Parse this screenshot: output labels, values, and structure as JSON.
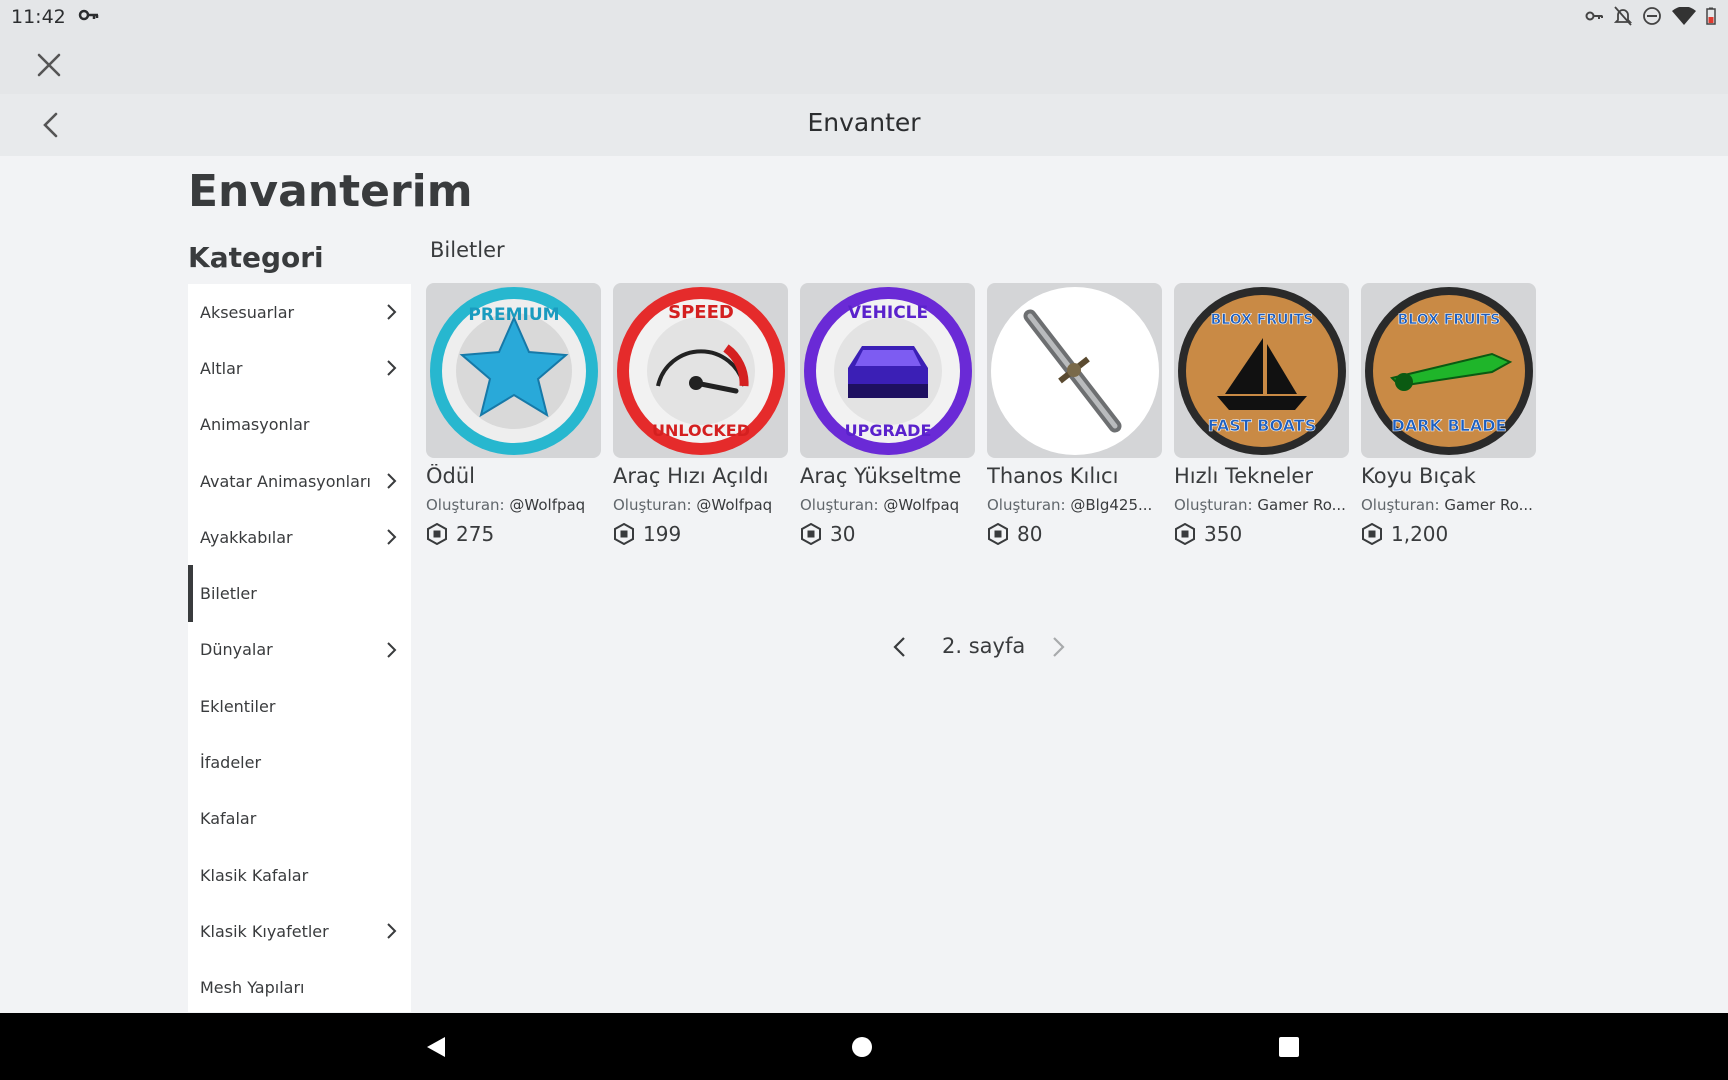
{
  "status_bar": {
    "time": "11:42",
    "icons": [
      "key-icon",
      "vpn-key-icon",
      "notifications-off-icon",
      "do-not-disturb-icon",
      "wifi-icon",
      "battery-icon"
    ]
  },
  "header": {
    "title": "Envanter"
  },
  "page": {
    "title": "Envanterim",
    "category_title": "Kategori"
  },
  "sidebar": {
    "items": [
      {
        "label": "Aksesuarlar",
        "has_arrow": true
      },
      {
        "label": "Altlar",
        "has_arrow": true
      },
      {
        "label": "Animasyonlar",
        "has_arrow": false
      },
      {
        "label": "Avatar Animasyonları",
        "has_arrow": true
      },
      {
        "label": "Ayakkabılar",
        "has_arrow": true
      },
      {
        "label": "Biletler",
        "has_arrow": false,
        "active": true
      },
      {
        "label": "Dünyalar",
        "has_arrow": true
      },
      {
        "label": "Eklentiler",
        "has_arrow": false
      },
      {
        "label": "İfadeler",
        "has_arrow": false
      },
      {
        "label": "Kafalar",
        "has_arrow": false
      },
      {
        "label": "Klasik Kafalar",
        "has_arrow": false
      },
      {
        "label": "Klasik Kıyafetler",
        "has_arrow": true
      },
      {
        "label": "Mesh Yapıları",
        "has_arrow": false
      }
    ]
  },
  "main": {
    "section_title": "Biletler",
    "creator_prefix": "Oluşturan:",
    "items": [
      {
        "name": "Ödül",
        "creator": "@Wolfpaq",
        "price": "275",
        "badge": {
          "top": "PREMIUM",
          "bottom": ""
        }
      },
      {
        "name": "Araç Hızı Açıldı",
        "creator": "@Wolfpaq",
        "price": "199",
        "badge": {
          "top": "SPEED",
          "bottom": "UNLOCKED"
        }
      },
      {
        "name": "Araç Yükseltme",
        "creator": "@Wolfpaq",
        "price": "30",
        "badge": {
          "top": "VEHICLE",
          "bottom": "UPGRADE"
        }
      },
      {
        "name": "Thanos Kılıcı",
        "creator": "@Blg425...",
        "price": "80",
        "badge": {
          "top": "",
          "bottom": ""
        }
      },
      {
        "name": "Hızlı Tekneler",
        "creator": "Gamer Ro...",
        "price": "350",
        "badge": {
          "top": "BLOX FRUITS",
          "bottom": "FAST BOATS"
        }
      },
      {
        "name": "Koyu Bıçak",
        "creator": "Gamer Ro...",
        "price": "1,200",
        "badge": {
          "top": "BLOX FRUITS",
          "bottom": "DARK BLADE"
        }
      }
    ]
  },
  "pagination": {
    "label": "2. sayfa"
  }
}
